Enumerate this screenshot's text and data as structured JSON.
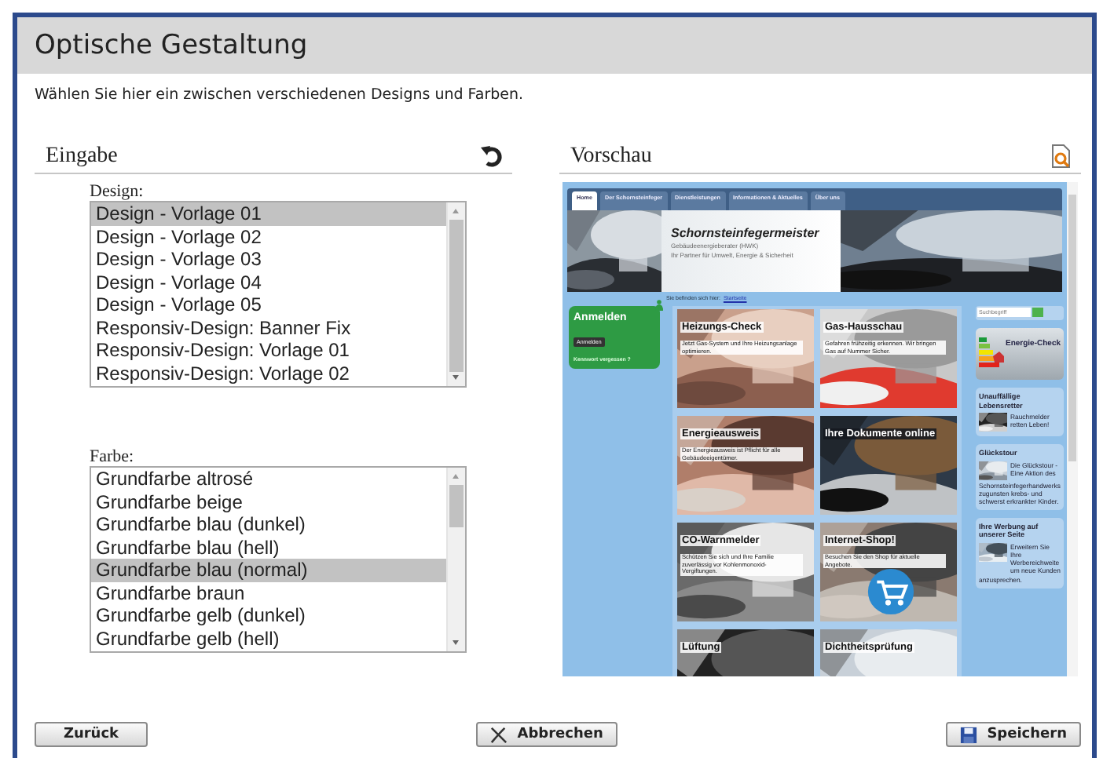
{
  "window": {
    "title": "Optische Gestaltung"
  },
  "intro": "Wählen Sie hier ein zwischen verschiedenen Designs und Farben.",
  "input_panel": {
    "heading": "Eingabe",
    "design": {
      "label": "Design:",
      "options": [
        {
          "label": "Design - Vorlage 01",
          "selected": true
        },
        {
          "label": "Design - Vorlage 02",
          "selected": false
        },
        {
          "label": "Design - Vorlage 03",
          "selected": false
        },
        {
          "label": "Design - Vorlage 04",
          "selected": false
        },
        {
          "label": "Design - Vorlage 05",
          "selected": false
        },
        {
          "label": "Responsiv-Design: Banner Fix",
          "selected": false
        },
        {
          "label": "Responsiv-Design: Vorlage 01",
          "selected": false
        },
        {
          "label": "Responsiv-Design: Vorlage 02",
          "selected": false
        }
      ]
    },
    "color": {
      "label": "Farbe:",
      "options": [
        {
          "label": "Grundfarbe altrosé",
          "selected": false
        },
        {
          "label": "Grundfarbe beige",
          "selected": false
        },
        {
          "label": "Grundfarbe blau (dunkel)",
          "selected": false
        },
        {
          "label": "Grundfarbe blau (hell)",
          "selected": false
        },
        {
          "label": "Grundfarbe blau (normal)",
          "selected": true
        },
        {
          "label": "Grundfarbe braun",
          "selected": false
        },
        {
          "label": "Grundfarbe gelb (dunkel)",
          "selected": false
        },
        {
          "label": "Grundfarbe gelb (hell)",
          "selected": false
        }
      ]
    }
  },
  "preview_panel": {
    "heading": "Vorschau",
    "site": {
      "nav": [
        {
          "label": "Home",
          "selected": true
        },
        {
          "label": "Der Schornsteinfeger",
          "selected": false
        },
        {
          "label": "Dienstleistungen",
          "selected": false
        },
        {
          "label": "Informationen & Aktuelles",
          "selected": false
        },
        {
          "label": "Über uns",
          "selected": false
        }
      ],
      "header": {
        "title": "Schornsteinfegermeister",
        "lines": [
          "Gebäudeenergieberater (HWK)",
          "Ihr Partner für Umwelt, Energie & Sicherheit"
        ]
      },
      "breadcrumb": {
        "prefix": "Sie befinden sich hier:",
        "link": "Startseite"
      },
      "login": {
        "title": "Anmelden",
        "button": "Anmelden",
        "link": "Kennwort vergessen ?"
      },
      "tiles": [
        {
          "title": "Heizungs-Check",
          "text": "Jetzt Gas-System und Ihre Heizungsanlage optimieren."
        },
        {
          "title": "Gas-Hausschau",
          "text": "Gefahren frühzeitig erkennen. Wir bringen Gas auf Nummer Sicher."
        },
        {
          "title": "Energieausweis",
          "text": "Der Energieausweis ist Pflicht für alle Gebäudeeigentümer."
        },
        {
          "title": "Ihre Dokumente online"
        },
        {
          "title": "CO-Warnmelder",
          "text": "Schützen Sie sich und Ihre Familie zuverlässig vor Kohlenmonoxid-Vergiftungen."
        },
        {
          "title": "Internet-Shop!",
          "text": "Besuchen Sie den Shop für aktuelle Angebote."
        },
        {
          "title": "Lüftung"
        },
        {
          "title": "Dichtheitsprüfung"
        }
      ],
      "search": {
        "placeholder": "Suchbegriff"
      },
      "energy_check": "Energie-Check",
      "side_boxes": [
        {
          "title": "Unauffällige Lebensretter",
          "text": "Rauchmelder retten Leben!"
        },
        {
          "title": "Glückstour",
          "text": "Die Glückstour - Eine Aktion des",
          "more": "Schornsteinfegerhandwerks zugunsten krebs- und schwerst erkrankter Kinder."
        },
        {
          "title": "Ihre Werbung auf unserer Seite",
          "text": "Erweitern Sie Ihre Werbereichweite um neue Kunden",
          "more": "anzusprechen."
        }
      ]
    }
  },
  "buttons": [
    {
      "label": "Zurück",
      "kind": "back"
    },
    {
      "label": "Abbrechen",
      "kind": "cancel"
    },
    {
      "label": "Speichern",
      "kind": "save"
    }
  ]
}
